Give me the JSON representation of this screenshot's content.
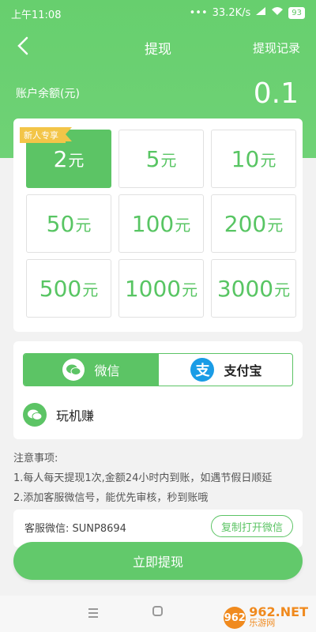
{
  "status_bar": {
    "time": "上午11:08",
    "network_speed": "33.2K/s",
    "battery": "93",
    "icons": [
      "dots-icon",
      "signal-icon",
      "wifi-icon",
      "battery-icon"
    ]
  },
  "header": {
    "title": "提现",
    "right_link": "提现记录",
    "back_icon": "back-arrow-icon"
  },
  "balance": {
    "label": "账户余额(元)",
    "value": "0.1"
  },
  "amounts": {
    "badge": "新人专享",
    "unit": "元",
    "selected_index": 0,
    "options": [
      "2",
      "5",
      "10",
      "50",
      "100",
      "200",
      "500",
      "1000",
      "3000"
    ]
  },
  "payment": {
    "wechat_label": "微信",
    "alipay_label": "支付宝",
    "alipay_glyph": "支",
    "selected": "wechat",
    "account_name": "玩机赚"
  },
  "notice": {
    "title": "注意事项:",
    "lines": [
      "1.每人每天提现1次,金额24小时内到账，如遇节假日顺延",
      "2.添加客服微信号，能优先审核，秒到账哦"
    ]
  },
  "service": {
    "text": "客服微信: SUNP8694",
    "copy_button": "复制打开微信"
  },
  "withdraw_button": "立即提现",
  "watermark": {
    "logo": "962",
    "top": "962.NET",
    "bottom": "乐游网"
  },
  "colors": {
    "primary_green": "#5cc465",
    "badge_yellow": "#f3c548",
    "alipay_blue": "#1a9ce6"
  }
}
